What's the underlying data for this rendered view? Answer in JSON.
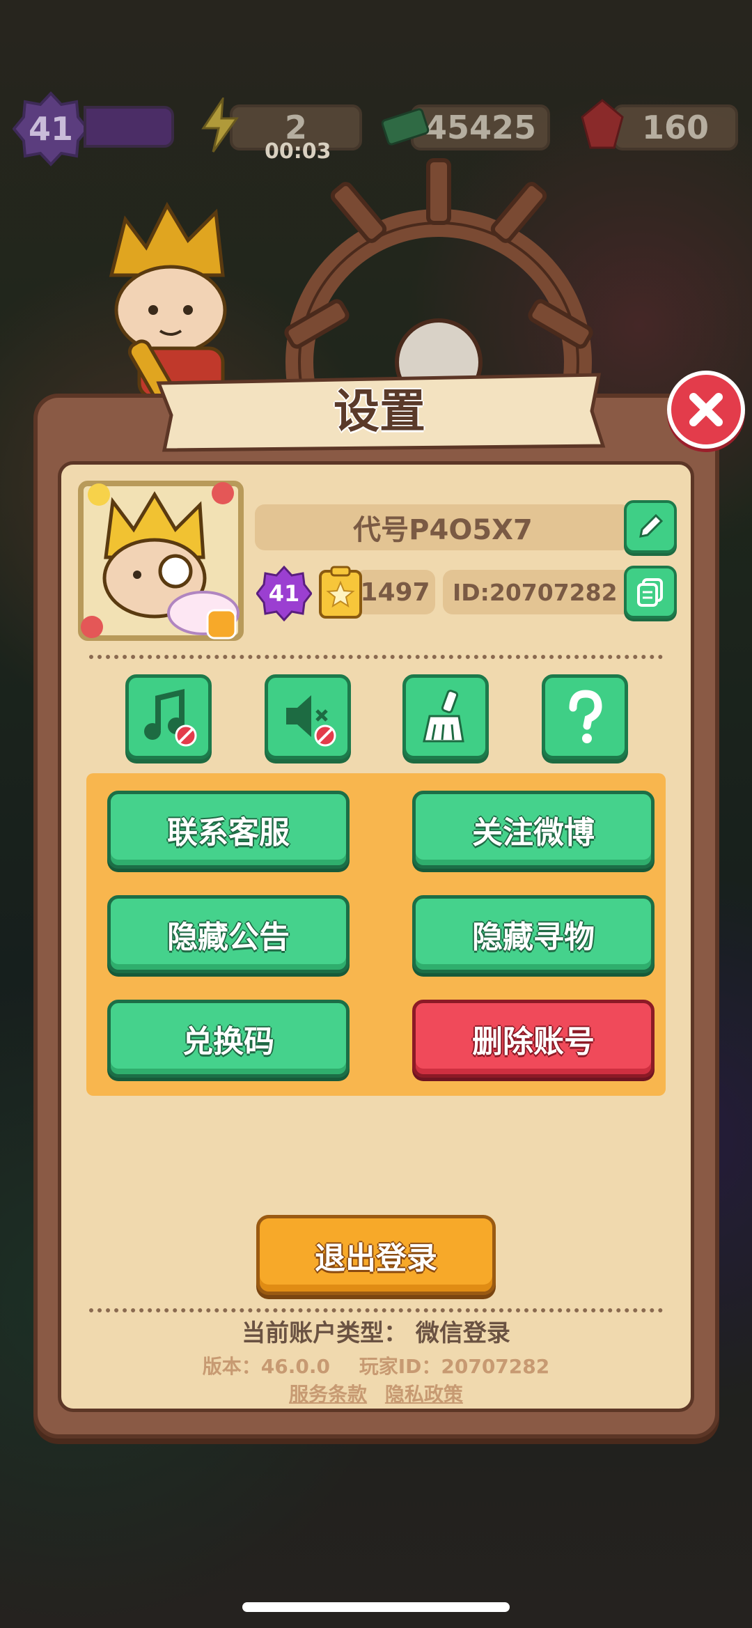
{
  "hud": {
    "level": "41",
    "energy": "2",
    "energy_timer": "00:03",
    "cash": "45425",
    "gems": "160"
  },
  "settings": {
    "title": "设置",
    "profile": {
      "codename": "代号P4O5X7",
      "level": "41",
      "score": "1497",
      "id_label": "ID:20707282"
    },
    "icon_buttons": [
      "music-off-icon",
      "sound-off-icon",
      "broom-icon",
      "question-icon"
    ],
    "actions": {
      "contact_support": "联系客服",
      "follow_weibo": "关注微博",
      "hide_announcement": "隐藏公告",
      "hide_search": "隐藏寻物",
      "redeem_code": "兑换码",
      "delete_account": "删除账号"
    },
    "logout": "退出登录",
    "account_type": "当前账户类型：  微信登录",
    "version": "版本：46.0.0",
    "player_id": "玩家ID：20707282",
    "terms": "服务条款",
    "privacy": "隐私政策"
  },
  "colors": {
    "green": "#45d28c",
    "red": "#f04a5a",
    "orange": "#f7a929",
    "panel": "#f0d9ae",
    "frame": "#8a5a45"
  }
}
